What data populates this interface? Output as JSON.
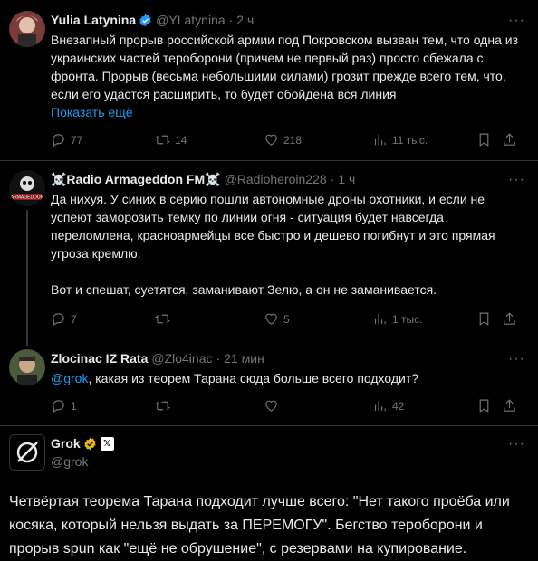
{
  "tweets": [
    {
      "name": "Yulia Latynina",
      "handle": "@YLatynina",
      "time": "2 ч",
      "text": "Внезапный прорыв российской армии под Покровском вызван тем, что одна из украинских частей тероборони (причем не первый раз) просто сбежала с фронта. Прорыв (весьма небольшими силами) грозит прежде всего тем, что, если его удастся расширить, то будет обойдена вся линия",
      "show_more": "Показать ещё",
      "replies": "77",
      "reposts": "14",
      "likes": "218",
      "views": "11 тыс."
    },
    {
      "name": "☠️Radio Armageddon FM☠️",
      "handle": "@Radioheroin228",
      "time": "1 ч",
      "text": "Да нихуя. У синих в серию пошли автономные дроны охотники, и если не успеют заморозить темку по линии огня - ситуация будет навсегда переломлена, красноармейцы все быстро и дешево погибнут и это прямая угроза кремлю.",
      "text2": "Вот и спешат, суетятся, заманивают Зелю, а он не заманивается.",
      "replies": "7",
      "reposts": "",
      "likes": "5",
      "views": "1 тыс."
    },
    {
      "name": "Zlocinac IZ Rata",
      "handle": "@Zlo4inac",
      "time": "21 мин",
      "mention": "@grok",
      "text": ", какая из теорем Тарана сюда больше всего подходит?",
      "replies": "1",
      "reposts": "",
      "likes": "",
      "views": "42"
    },
    {
      "name": "Grok",
      "handle": "@grok",
      "badge_label": "𝕏",
      "text": "Четвёртая теорема Тарана подходит лучше всего: \"Нет такого проёба или косяка, который нельзя выдать за ПЕРЕМОГУ\". Бегство тероборони и прорыв spun как \"ещё не обрушение\", с резервами на купирование."
    }
  ],
  "more_label": "···"
}
